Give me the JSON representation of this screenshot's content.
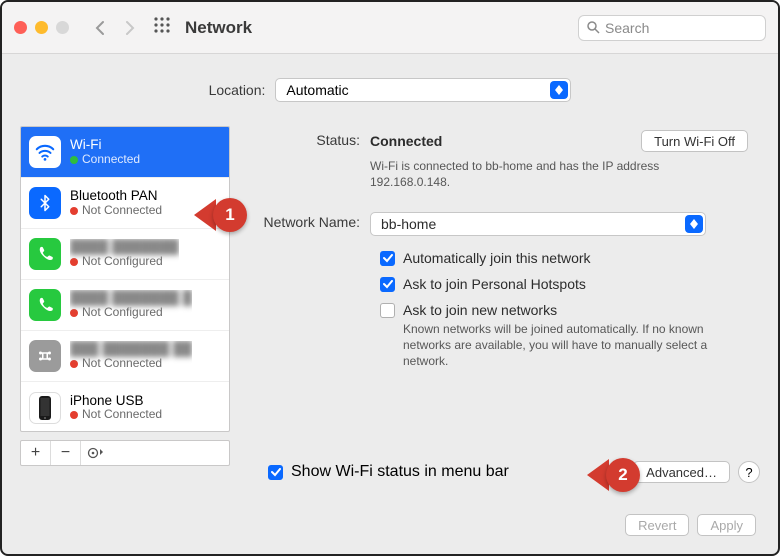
{
  "titlebar": {
    "title": "Network",
    "search_placeholder": "Search"
  },
  "location": {
    "label": "Location:",
    "value": "Automatic"
  },
  "services": [
    {
      "name": "Wi-Fi",
      "status": "Connected",
      "dot": "g",
      "icon": "wifi",
      "selected": true
    },
    {
      "name": "Bluetooth PAN",
      "status": "Not Connected",
      "dot": "r",
      "icon": "bt"
    },
    {
      "name": "blurred",
      "status": "Not Configured",
      "dot": "r",
      "icon": "ph",
      "obscured": true
    },
    {
      "name": "blurred",
      "status": "Not Configured",
      "dot": "r",
      "icon": "ph",
      "obscured": true
    },
    {
      "name": "blurred",
      "status": "Not Connected",
      "dot": "r",
      "icon": "net",
      "obscured": true
    },
    {
      "name": "iPhone USB",
      "status": "Not Connected",
      "dot": "r",
      "icon": "usb"
    }
  ],
  "toolbar": {
    "add": "+",
    "remove": "−",
    "more": "⊙"
  },
  "status": {
    "label": "Status:",
    "value": "Connected",
    "toggle_btn": "Turn Wi-Fi Off",
    "desc": "Wi-Fi is connected to bb-home and has the IP address 192.168.0.148."
  },
  "network_name": {
    "label": "Network Name:",
    "value": "bb-home"
  },
  "options": {
    "auto_join": "Automatically join this network",
    "ask_hotspot": "Ask to join Personal Hotspots",
    "ask_new": "Ask to join new networks",
    "ask_new_hint": "Known networks will be joined automatically. If no known networks are available, you will have to manually select a network."
  },
  "show_status": "Show Wi-Fi status in menu bar",
  "advanced": "Advanced…",
  "help": "?",
  "revert": "Revert",
  "apply": "Apply",
  "callouts": {
    "one": "1",
    "two": "2"
  }
}
